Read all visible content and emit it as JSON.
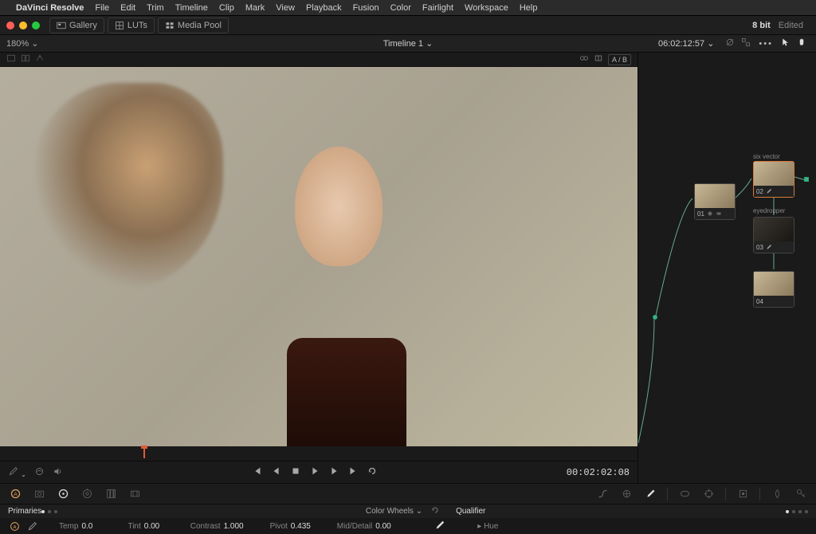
{
  "menubar": {
    "app": "DaVinci Resolve",
    "items": [
      "File",
      "Edit",
      "Trim",
      "Timeline",
      "Clip",
      "Mark",
      "View",
      "Playback",
      "Fusion",
      "Color",
      "Fairlight",
      "Workspace",
      "Help"
    ]
  },
  "toolbar": {
    "gallery": "Gallery",
    "luts": "LUTs",
    "mediapool": "Media Pool",
    "bitdepth": "8 bit",
    "edited": "Edited"
  },
  "viewer": {
    "zoom": "180%",
    "timeline_name": "Timeline 1",
    "master_timecode": "06:02:12:57",
    "ab_label": "A / B",
    "playhead_timecode": "00:02:02:08"
  },
  "nodes": {
    "n1": {
      "num": "01",
      "title": ""
    },
    "n2": {
      "num": "02",
      "title": "six vector"
    },
    "n3": {
      "num": "03",
      "title": "eyedropper"
    },
    "n4": {
      "num": "04",
      "title": ""
    }
  },
  "primaries": {
    "tab_label": "Primaries",
    "mode_label": "Color Wheels",
    "params": {
      "temp_label": "Temp",
      "temp_val": "0.0",
      "tint_label": "Tint",
      "tint_val": "0.00",
      "contrast_label": "Contrast",
      "contrast_val": "1.000",
      "pivot_label": "Pivot",
      "pivot_val": "0.435",
      "middetail_label": "Mid/Detail",
      "middetail_val": "0.00"
    }
  },
  "qualifier": {
    "label": "Qualifier",
    "hue_label": "Hue"
  },
  "icons": {
    "apple": "apple-icon",
    "chevron_down": "chevron-down-icon"
  }
}
